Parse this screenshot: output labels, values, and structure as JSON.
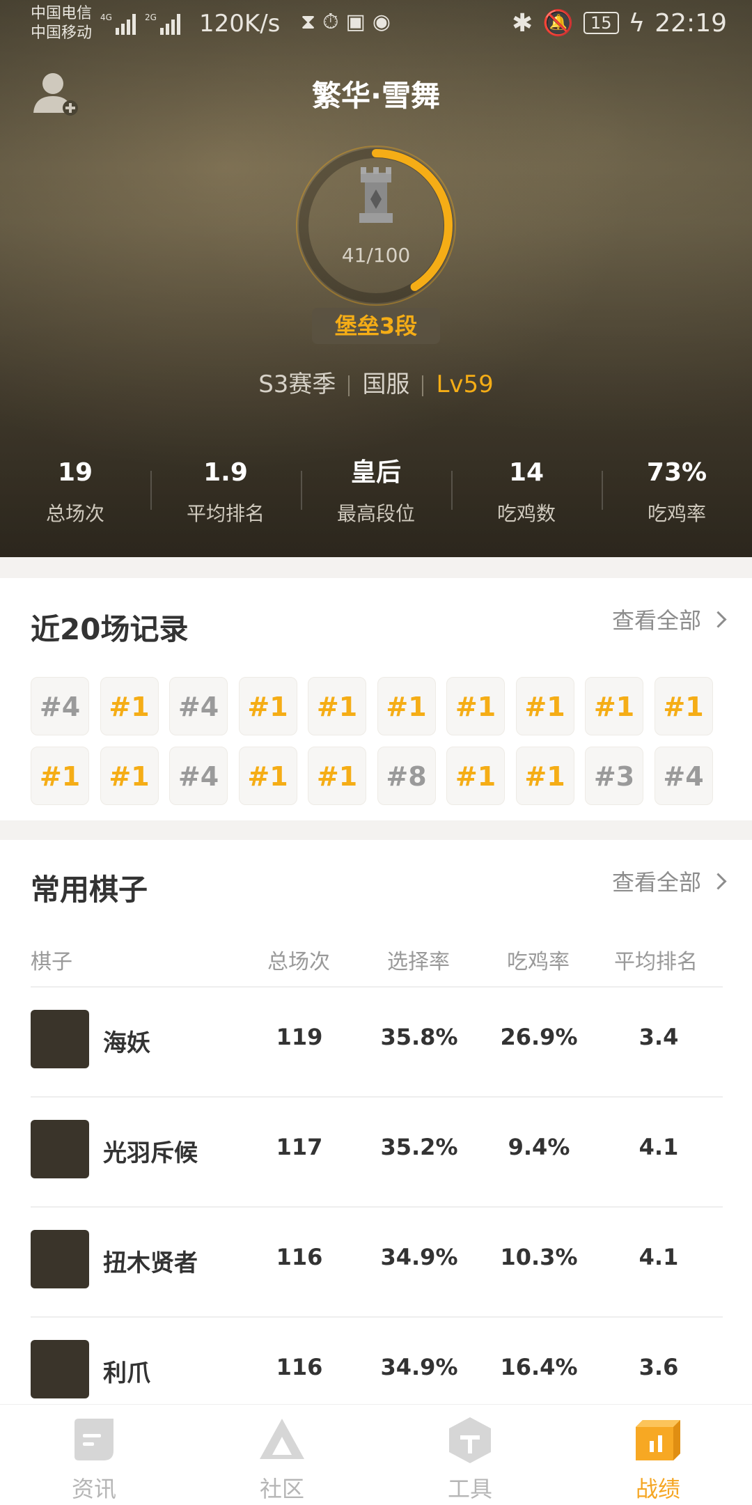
{
  "status_bar": {
    "carrier1": "中国电信",
    "carrier2": "中国移动",
    "net1": "4G",
    "net2": "2G",
    "speed": "120K/s",
    "battery": "15",
    "time": "22:19"
  },
  "profile": {
    "name": "繁华·雪舞",
    "progress_text": "41/100",
    "progress_value": 41,
    "progress_max": 100,
    "rank": "堡垒3段",
    "season": "S3赛季",
    "server": "国服",
    "level": "Lv59"
  },
  "stats": [
    {
      "value": "19",
      "label": "总场次"
    },
    {
      "value": "1.9",
      "label": "平均排名"
    },
    {
      "value": "皇后",
      "label": "最高段位"
    },
    {
      "value": "14",
      "label": "吃鸡数"
    },
    {
      "value": "73%",
      "label": "吃鸡率"
    }
  ],
  "records": {
    "title": "近20场记录",
    "see_all": "查看全部",
    "items": [
      "#4",
      "#1",
      "#4",
      "#1",
      "#1",
      "#1",
      "#1",
      "#1",
      "#1",
      "#1",
      "#1",
      "#1",
      "#4",
      "#1",
      "#1",
      "#8",
      "#1",
      "#1",
      "#3",
      "#4"
    ]
  },
  "common_pieces": {
    "title": "常用棋子",
    "see_all": "查看全部",
    "headers": [
      "棋子",
      "总场次",
      "选择率",
      "吃鸡率",
      "平均排名"
    ],
    "rows": [
      {
        "name": "海妖",
        "games": "119",
        "pick_rate": "35.8%",
        "win_rate": "26.9%",
        "avg_rank": "3.4"
      },
      {
        "name": "光羽斥候",
        "games": "117",
        "pick_rate": "35.2%",
        "win_rate": "9.4%",
        "avg_rank": "4.1"
      },
      {
        "name": "扭木贤者",
        "games": "116",
        "pick_rate": "34.9%",
        "win_rate": "10.3%",
        "avg_rank": "4.1"
      },
      {
        "name": "利爪",
        "games": "116",
        "pick_rate": "34.9%",
        "win_rate": "16.4%",
        "avg_rank": "3.6"
      }
    ]
  },
  "bottom_nav": [
    {
      "label": "资讯",
      "icon": "news-icon",
      "active": false
    },
    {
      "label": "社区",
      "icon": "community-icon",
      "active": false
    },
    {
      "label": "工具",
      "icon": "tools-icon",
      "active": false
    },
    {
      "label": "战绩",
      "icon": "stats-icon",
      "active": true
    }
  ],
  "colors": {
    "accent": "#f5ad16",
    "header_bg": "#4a4434",
    "loss_rank": "#9a9a9a"
  }
}
